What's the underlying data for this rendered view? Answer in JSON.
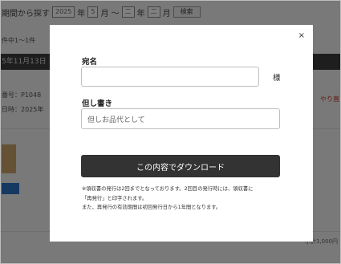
{
  "background": {
    "period_label": "期間から探す",
    "year_from": "2025",
    "month_from": "5",
    "year_to": "二",
    "month_to": "二",
    "search_button": "検索",
    "result_count": "件中1〜1件",
    "order_date_header": "5年11月13日",
    "order_number": "番号：P1048",
    "order_date": "日時：2025年",
    "red_text": "やり直",
    "bottom_text": "小計1,000円"
  },
  "modal": {
    "close_icon": "×",
    "addressee_label": "宛名",
    "addressee_value": "",
    "honorific": "様",
    "memo_label": "但し書き",
    "memo_placeholder": "但しお品代として",
    "download_button": "この内容でダウンロード",
    "notes": [
      "※領収書の発行は2回までとなっております。2回目の発行時には、領収書に",
      "「再発行」と印字されます。",
      "また、再発行の有効期間は初回発行日から1年間となります。"
    ]
  }
}
